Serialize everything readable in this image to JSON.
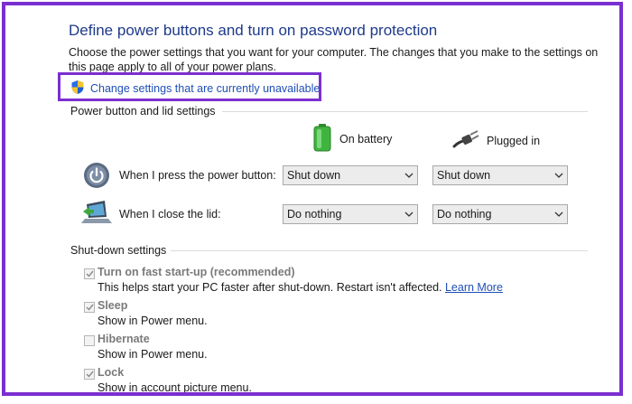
{
  "header": {
    "title": "Define power buttons and turn on password protection",
    "description": "Choose the power settings that you want for your computer. The changes that you make to the settings on this page apply to all of your power plans.",
    "change_link": "Change settings that are currently unavailable"
  },
  "power_section": {
    "label": "Power button and lid settings",
    "columns": {
      "battery": "On battery",
      "plugged": "Plugged in"
    },
    "rows": [
      {
        "label": "When I press the power button:",
        "battery": "Shut down",
        "plugged": "Shut down"
      },
      {
        "label": "When I close the lid:",
        "battery": "Do nothing",
        "plugged": "Do nothing"
      }
    ]
  },
  "shutdown_section": {
    "label": "Shut-down settings",
    "options": [
      {
        "label": "Turn on fast start-up (recommended)",
        "desc": "This helps start your PC faster after shut-down. Restart isn't affected.",
        "link": "Learn More",
        "checked": true
      },
      {
        "label": "Sleep",
        "desc": "Show in Power menu.",
        "checked": true
      },
      {
        "label": "Hibernate",
        "desc": "Show in Power menu.",
        "checked": false
      },
      {
        "label": "Lock",
        "desc": "Show in account picture menu.",
        "checked": true
      }
    ]
  },
  "colors": {
    "highlight_border": "#7b2fd0",
    "link": "#1f4fb6",
    "title": "#1e3a8a"
  },
  "icons": [
    "shield-icon",
    "battery-icon",
    "plug-icon",
    "power-button-icon",
    "laptop-lid-icon",
    "chevron-down-icon",
    "checkmark-icon"
  ]
}
